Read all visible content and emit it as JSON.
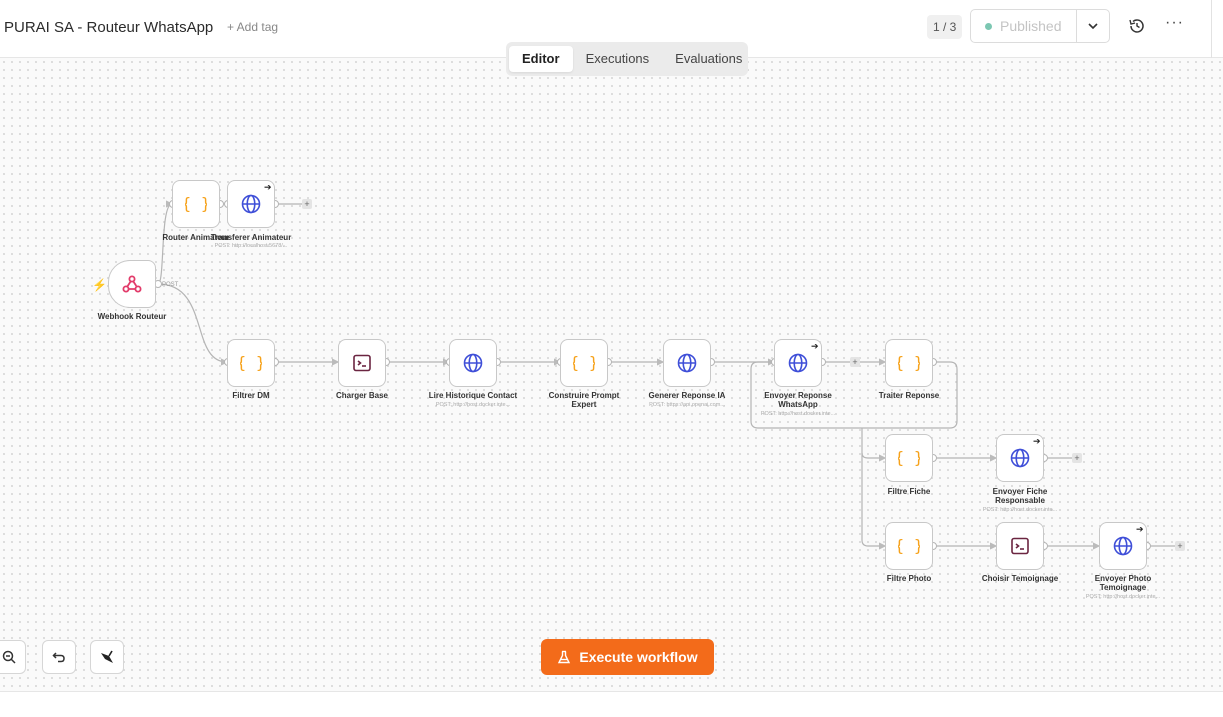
{
  "header": {
    "title": "PURAI SA - Routeur WhatsApp",
    "add_tag": "+ Add tag",
    "counter": "1 / 3",
    "publish_label": "Published",
    "more": "···"
  },
  "tabs": [
    "Editor",
    "Executions",
    "Evaluations"
  ],
  "active_tab": "Editor",
  "nodes": {
    "webhook": {
      "label": "Webhook Routeur",
      "icon": "webhook-icon",
      "port": "POST"
    },
    "router_animateur": {
      "label": "Router Animateur",
      "icon": "code-braces-icon"
    },
    "transferer_animateur": {
      "label": "Transferer Animateur",
      "sub": "POST: http://localhost:5678/...",
      "icon": "globe-icon"
    },
    "filtrer_dm": {
      "label": "Filtrer DM",
      "icon": "code-braces-icon"
    },
    "charger_base": {
      "label": "Charger Base",
      "icon": "terminal-icon"
    },
    "lire_historique": {
      "label": "Lire Historique Contact",
      "sub": "POST: http://host.docker.inte...",
      "icon": "globe-icon"
    },
    "construire_prompt": {
      "label": "Construire Prompt Expert",
      "icon": "code-braces-icon"
    },
    "generer_reponse": {
      "label": "Generer Reponse IA",
      "sub": "POST: https://api.openai.com...",
      "icon": "globe-icon"
    },
    "envoyer_reponse": {
      "label": "Envoyer Reponse WhatsApp",
      "sub": "POST: http://host.docker.inte...",
      "icon": "globe-icon"
    },
    "traiter_reponse": {
      "label": "Traiter Reponse",
      "icon": "code-braces-icon"
    },
    "filtre_fiche": {
      "label": "Filtre Fiche",
      "icon": "code-braces-icon"
    },
    "envoyer_fiche": {
      "label": "Envoyer Fiche Responsable",
      "sub": "POST: http://host.docker.inte...",
      "icon": "globe-icon"
    },
    "filtre_photo": {
      "label": "Filtre Photo",
      "icon": "code-braces-icon"
    },
    "choisir_temoignage": {
      "label": "Choisir Temoignage",
      "icon": "terminal-icon"
    },
    "envoyer_photo": {
      "label": "Envoyer Photo Temoignage",
      "sub": "POST: http://host.docker.inte...",
      "icon": "globe-icon"
    }
  },
  "canvas_controls": {
    "zoom_out": "zoom-out-icon",
    "undo": "undo-icon",
    "tidy": "tidy-broom-icon"
  },
  "execute_label": "Execute workflow",
  "colors": {
    "accent": "#f36b1a",
    "code": "#f6a21b",
    "http": "#3f4fd8",
    "terminal": "#6b2541",
    "webhook": "#e23b6a",
    "published_dot": "#7cc7b2"
  }
}
